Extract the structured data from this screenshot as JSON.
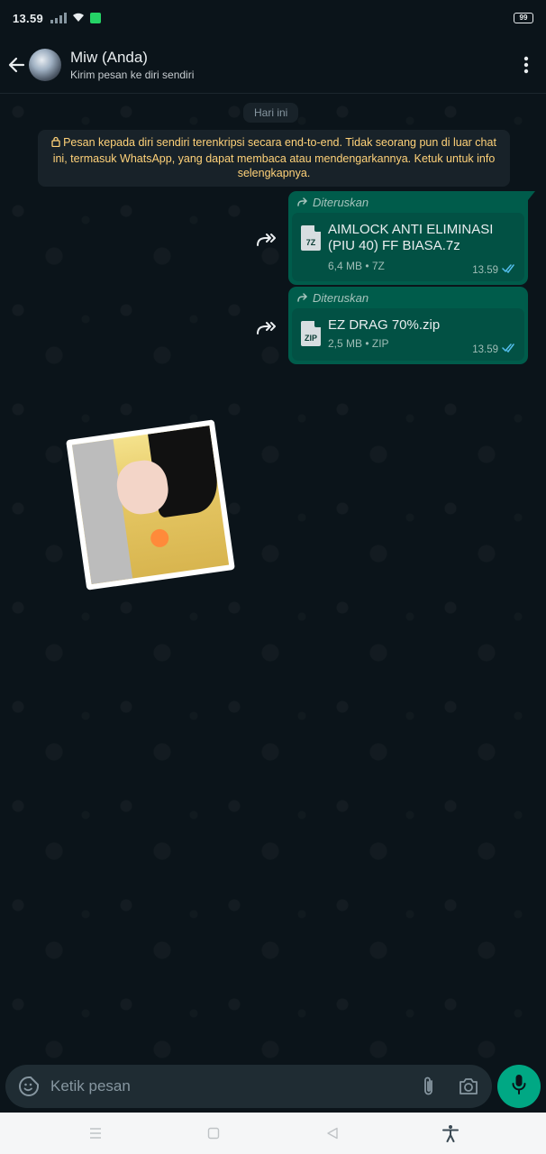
{
  "status_bar": {
    "time": "13.59",
    "battery": "99",
    "icons": [
      "signal-icon",
      "wifi-icon",
      "notification-icon",
      "battery-icon"
    ]
  },
  "header": {
    "title": "Miw (Anda)",
    "subtitle": "Kirim pesan ke diri sendiri"
  },
  "chat": {
    "day_label": "Hari ini",
    "encryption_notice": "Pesan kepada diri sendiri terenkripsi secara end-to-end. Tidak seorang pun di luar chat ini, termasuk WhatsApp, yang dapat membaca atau mendengarkannya. Ketuk untuk info selengkapnya.",
    "messages": [
      {
        "forwarded_label": "Diteruskan",
        "file_badge": "7Z",
        "file_name": "AIMLOCK ANTI ELIMINASI (PIU 40) FF BIASA.7z",
        "file_meta": "6,4 MB • 7Z",
        "time": "13.59"
      },
      {
        "forwarded_label": "Diteruskan",
        "file_badge": "ZIP",
        "file_name": "EZ DRAG 70%.zip",
        "file_meta": "2,5 MB • ZIP",
        "time": "13.59"
      }
    ]
  },
  "input": {
    "placeholder": "Ketik pesan"
  },
  "colors": {
    "background": "#0b141a",
    "outgoing_bubble": "#005c4b",
    "accent": "#00a884",
    "notice_text": "#ffd279",
    "read_ticks": "#53bdeb"
  }
}
